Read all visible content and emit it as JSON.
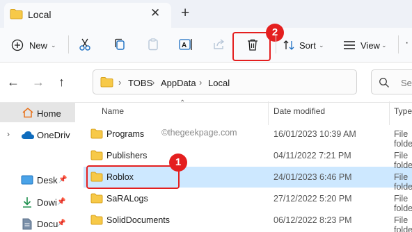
{
  "tab": {
    "title": "Local",
    "close_glyph": "✕",
    "new_tab_glyph": "+"
  },
  "toolbar": {
    "new_label": "New",
    "sort_label": "Sort",
    "view_label": "View",
    "more_glyph": "·"
  },
  "nav": {
    "back": "←",
    "forward": "→",
    "up": "↑"
  },
  "breadcrumb": [
    "TOBS",
    "AppData",
    "Local"
  ],
  "breadcrumb_sep": "›",
  "search": {
    "placeholder": "Sea"
  },
  "sidebar": {
    "items": [
      {
        "label": "Home",
        "icon": "home-icon"
      },
      {
        "label": "OneDriv",
        "icon": "cloud-icon"
      },
      {
        "label": "Desk",
        "icon": "desktop-icon"
      },
      {
        "label": "Dowi",
        "icon": "download-icon"
      },
      {
        "label": "Docu",
        "icon": "document-icon"
      }
    ]
  },
  "columns": {
    "name": "Name",
    "date": "Date modified",
    "type": "Type"
  },
  "watermark": "©thegeekpage.com",
  "files": [
    {
      "name": "Programs",
      "date": "16/01/2023 10:39 AM",
      "type": "File folder"
    },
    {
      "name": "Publishers",
      "date": "04/11/2022 7:21 PM",
      "type": "File folder"
    },
    {
      "name": "Roblox",
      "date": "24/01/2023 6:46 PM",
      "type": "File folder"
    },
    {
      "name": "SaRALogs",
      "date": "27/12/2022 5:20 PM",
      "type": "File folder"
    },
    {
      "name": "SolidDocuments",
      "date": "06/12/2022 8:23 PM",
      "type": "File folder"
    }
  ],
  "annotations": {
    "step1": "1",
    "step2": "2"
  },
  "colors": {
    "selection": "#cde8ff",
    "accent": "#0067c0",
    "annotation": "#e41f1f",
    "folder": "#f7c948"
  }
}
